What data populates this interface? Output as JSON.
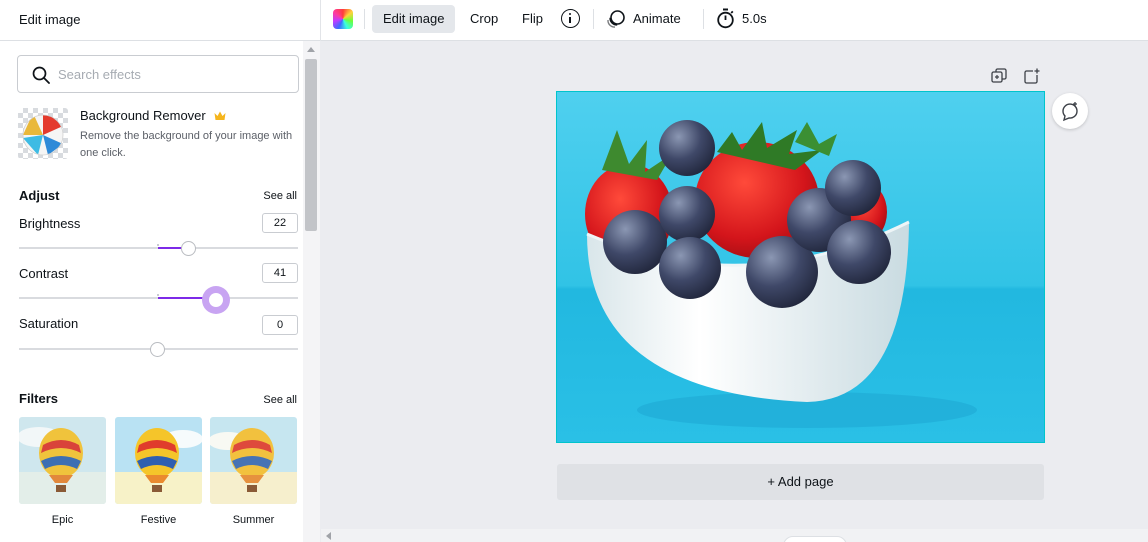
{
  "panel": {
    "title": "Edit image",
    "search_placeholder": "Search effects",
    "background_remover": {
      "title": "Background Remover",
      "description": "Remove the background of your image with one click.",
      "premium_icon": "crown-icon"
    },
    "adjust": {
      "heading": "Adjust",
      "see_all": "See all",
      "sliders": [
        {
          "label": "Brightness",
          "value": "22"
        },
        {
          "label": "Contrast",
          "value": "41"
        },
        {
          "label": "Saturation",
          "value": "0"
        }
      ]
    },
    "filters": {
      "heading": "Filters",
      "see_all": "See all",
      "items": [
        {
          "label": "Epic"
        },
        {
          "label": "Festive"
        },
        {
          "label": "Summer"
        }
      ]
    }
  },
  "toolbar": {
    "color_icon": "color-palette-icon",
    "edit_image": "Edit image",
    "crop": "Crop",
    "flip": "Flip",
    "info_icon": "info-icon",
    "animate": "Animate",
    "duration": "5.0s"
  },
  "canvas": {
    "add_page": "+ Add page",
    "page_icons": [
      "duplicate-page-icon",
      "add-page-icon"
    ],
    "comment_icon": "add-comment-icon"
  },
  "colors": {
    "accent": "#7d2ae8",
    "accent_light": "#c8a4f2",
    "selection": "#00c4cc",
    "canvas_bg": "#ebecf0"
  }
}
